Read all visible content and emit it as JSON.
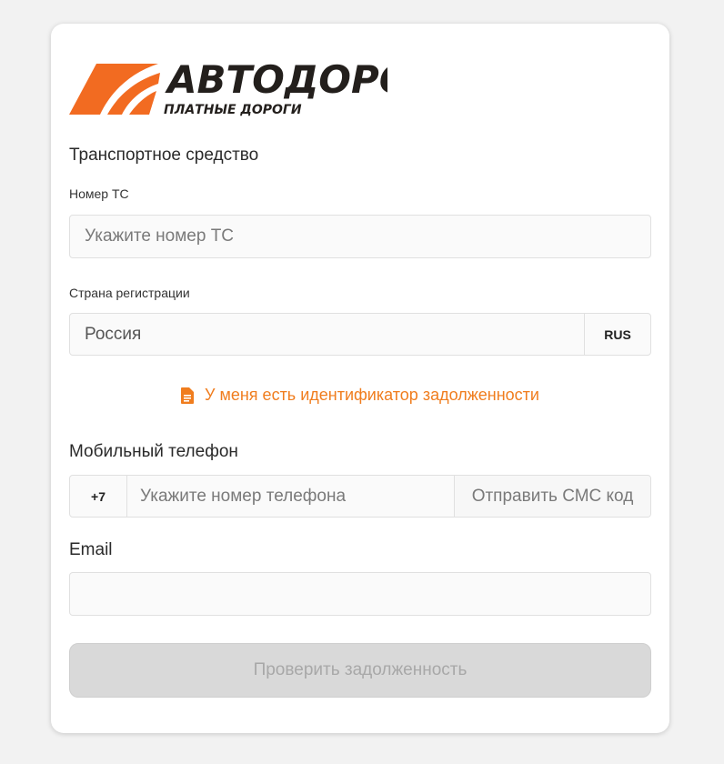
{
  "logo": {
    "brand_text": "АВТОДОРОГИ",
    "tagline": "ПЛАТНЫЕ ДОРОГИ",
    "accent_color": "#f26b21",
    "text_color": "#231f1c"
  },
  "vehicle": {
    "section_title": "Транспортное средство",
    "plate_label": "Номер ТС",
    "plate_placeholder": "Укажите номер ТС",
    "plate_value": "",
    "country_label": "Страна регистрации",
    "country_value": "Россия",
    "country_code": "RUS"
  },
  "debt_link": {
    "icon": "document-icon",
    "label": "У меня есть идентификатор задолженности",
    "color": "#f07d1e"
  },
  "phone": {
    "section_title": "Мобильный телефон",
    "prefix": "+7",
    "placeholder": "Укажите номер телефона",
    "value": "",
    "send_sms_label": "Отправить СМС код"
  },
  "email": {
    "section_title": "Email",
    "value": ""
  },
  "submit": {
    "label": "Проверить задолженность",
    "disabled": true
  }
}
